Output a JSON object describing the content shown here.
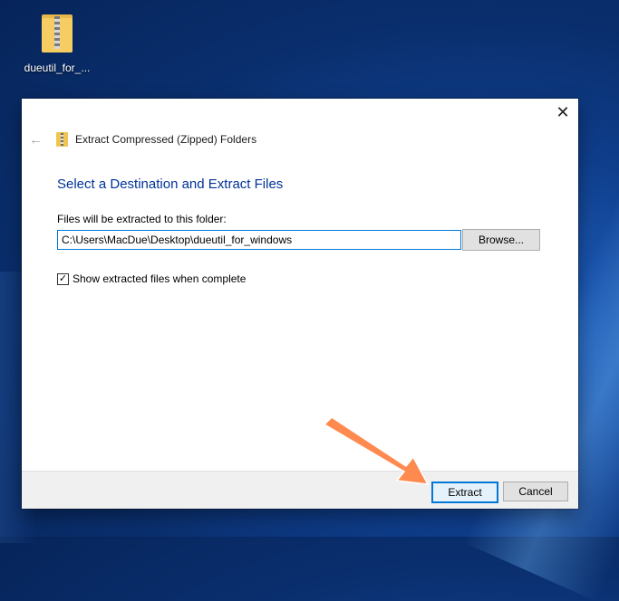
{
  "desktop": {
    "icon_label": "dueutil_for_...",
    "icon": "zip-folder-icon"
  },
  "dialog": {
    "close_glyph": "✕",
    "back_glyph": "←",
    "title": "Extract Compressed (Zipped) Folders",
    "heading": "Select a Destination and Extract Files",
    "destination_label": "Files will be extracted to this folder:",
    "destination_path": "C:\\Users\\MacDue\\Desktop\\dueutil_for_windows",
    "browse_label": "Browse...",
    "show_files_label": "Show extracted files when complete",
    "show_files_checked": true,
    "checkmark": "✓",
    "extract_label": "Extract",
    "cancel_label": "Cancel"
  },
  "colors": {
    "heading": "#003399",
    "focus_border": "#0078d7",
    "annotation_arrow": "#ff8a50"
  }
}
